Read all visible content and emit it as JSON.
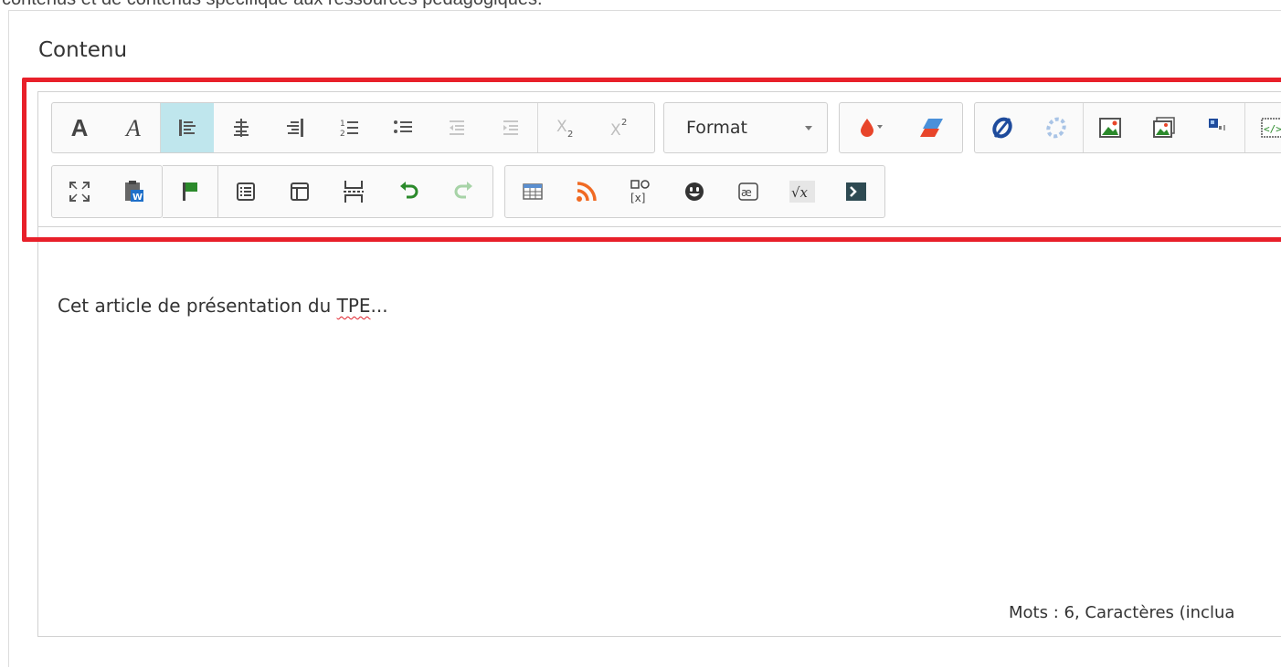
{
  "page": {
    "top_text": "contenus et de contenus spécifique aux ressources pédagogiques.",
    "section_label": "Contenu"
  },
  "toolbar": {
    "row1": {
      "group_text": [
        {
          "name": "bold-icon",
          "label": "Bold",
          "state": "enabled"
        },
        {
          "name": "italic-icon",
          "label": "Italic",
          "state": "enabled"
        },
        {
          "name": "align-left-icon",
          "label": "Align left",
          "state": "active"
        },
        {
          "name": "align-center-icon",
          "label": "Center",
          "state": "enabled"
        },
        {
          "name": "align-right-icon",
          "label": "Align right",
          "state": "enabled"
        },
        {
          "name": "numbered-list-icon",
          "label": "Numbered list",
          "state": "enabled"
        },
        {
          "name": "bulleted-list-icon",
          "label": "Bulleted list",
          "state": "enabled"
        },
        {
          "name": "outdent-icon",
          "label": "Decrease indent",
          "state": "disabled"
        },
        {
          "name": "indent-icon",
          "label": "Increase indent",
          "state": "disabled"
        },
        {
          "name": "subscript-icon",
          "label": "Subscript",
          "state": "disabled"
        },
        {
          "name": "superscript-icon",
          "label": "Superscript",
          "state": "disabled"
        }
      ],
      "format_label": "Format",
      "group_color": [
        "text-color-icon",
        "remove-format-icon"
      ],
      "group_media": [
        "link-icon",
        "unlink-icon",
        "image-icon",
        "image-gallery-icon",
        "media-icon",
        "source-code-icon"
      ]
    },
    "row2": {
      "group_a": [
        "maximize-icon",
        "paste-from-word-icon"
      ],
      "group_b": [
        "anchor-flag-icon"
      ],
      "group_c": [
        "blockquote-icon",
        "template-icon",
        "page-break-icon"
      ],
      "group_d": [
        "undo-icon",
        "redo-icon"
      ],
      "group_e": [
        "table-icon",
        "rss-icon",
        "qr-code-icon",
        "emoji-icon",
        "special-char-icon",
        "math-formula-icon",
        "code-terminal-icon"
      ]
    }
  },
  "editor": {
    "content_prefix": "Cet article de présentation du ",
    "content_misspelled": "TPE",
    "content_suffix": "...",
    "status": "Mots : 6, Caractères (inclua"
  },
  "colors": {
    "highlight_border": "#e8202a",
    "active_button_bg": "#bfe6ed",
    "green_icon": "#2b8a2b",
    "blue_icon": "#1e4b9c"
  }
}
